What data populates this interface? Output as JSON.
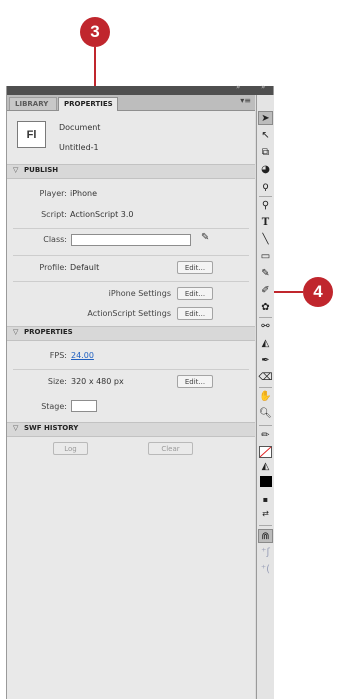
{
  "callouts": {
    "step_a": "3",
    "step_b": "4"
  },
  "panel": {
    "tabs": [
      "LIBRARY",
      "PROPERTIES"
    ],
    "collapse_arrows_left": "»",
    "collapse_arrows_right": "»",
    "menu_glyph": "▾≡"
  },
  "document": {
    "icon_text": "Fl",
    "type_label": "Document",
    "name": "Untitled-1"
  },
  "publish": {
    "section_title": "PUBLISH",
    "player_label": "Player:",
    "player_value": "iPhone",
    "script_label": "Script:",
    "script_value": "ActionScript 3.0",
    "class_label": "Class:",
    "class_value": "",
    "profile_label": "Profile:",
    "profile_value": "Default",
    "edit_label": "Edit...",
    "iphone_settings_label": "iPhone Settings",
    "as_settings_label": "ActionScript Settings"
  },
  "properties": {
    "section_title": "PROPERTIES",
    "fps_label": "FPS:",
    "fps_value": "24.00",
    "size_label": "Size:",
    "size_value": "320 x 480 px",
    "stage_label": "Stage:",
    "stage_color": "#ffffff"
  },
  "swf_history": {
    "section_title": "SWF HISTORY",
    "log_label": "Log",
    "clear_label": "Clear"
  },
  "colors": {
    "callout": "#c0262d",
    "link": "#2060c0",
    "panel_bg": "#e9e9e9"
  },
  "toolbar": {
    "tools": [
      "selection-tool",
      "subselection-tool",
      "free-transform-tool",
      "3d-rotation-tool",
      "lasso-tool",
      "pen-tool",
      "text-tool",
      "line-tool",
      "rectangle-tool",
      "pencil-tool",
      "brush-tool",
      "deco-tool",
      "bone-tool",
      "paint-bucket-tool",
      "eyedropper-tool",
      "eraser-tool",
      "hand-tool",
      "zoom-tool",
      "stroke-color",
      "fill-color",
      "swap-colors",
      "snap-to-objects",
      "smooth-option",
      "straighten-option"
    ]
  }
}
